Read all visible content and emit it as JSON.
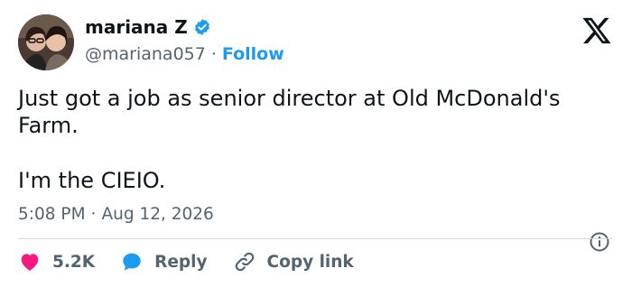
{
  "user": {
    "display_name": "mariana Z",
    "handle": "@mariana057",
    "separator": "·",
    "follow_label": "Follow"
  },
  "tweet": {
    "line1": "Just got a job as senior director at Old McDonald's Farm.",
    "line2": "I'm the CIEIO."
  },
  "meta": {
    "time": "5:08 PM",
    "separator": "·",
    "date": "Aug 12, 2026"
  },
  "actions": {
    "likes": "5.2K",
    "reply_label": "Reply",
    "copy_link_label": "Copy link"
  },
  "colors": {
    "accent": "#1d9bf0",
    "like": "#f91880",
    "text": "#0f1419",
    "muted": "#536471"
  },
  "icons": {
    "verified": "verified-badge-icon",
    "brand": "x-logo-icon",
    "info": "info-icon",
    "like": "heart-icon",
    "reply": "speech-bubble-icon",
    "copy": "link-icon"
  }
}
